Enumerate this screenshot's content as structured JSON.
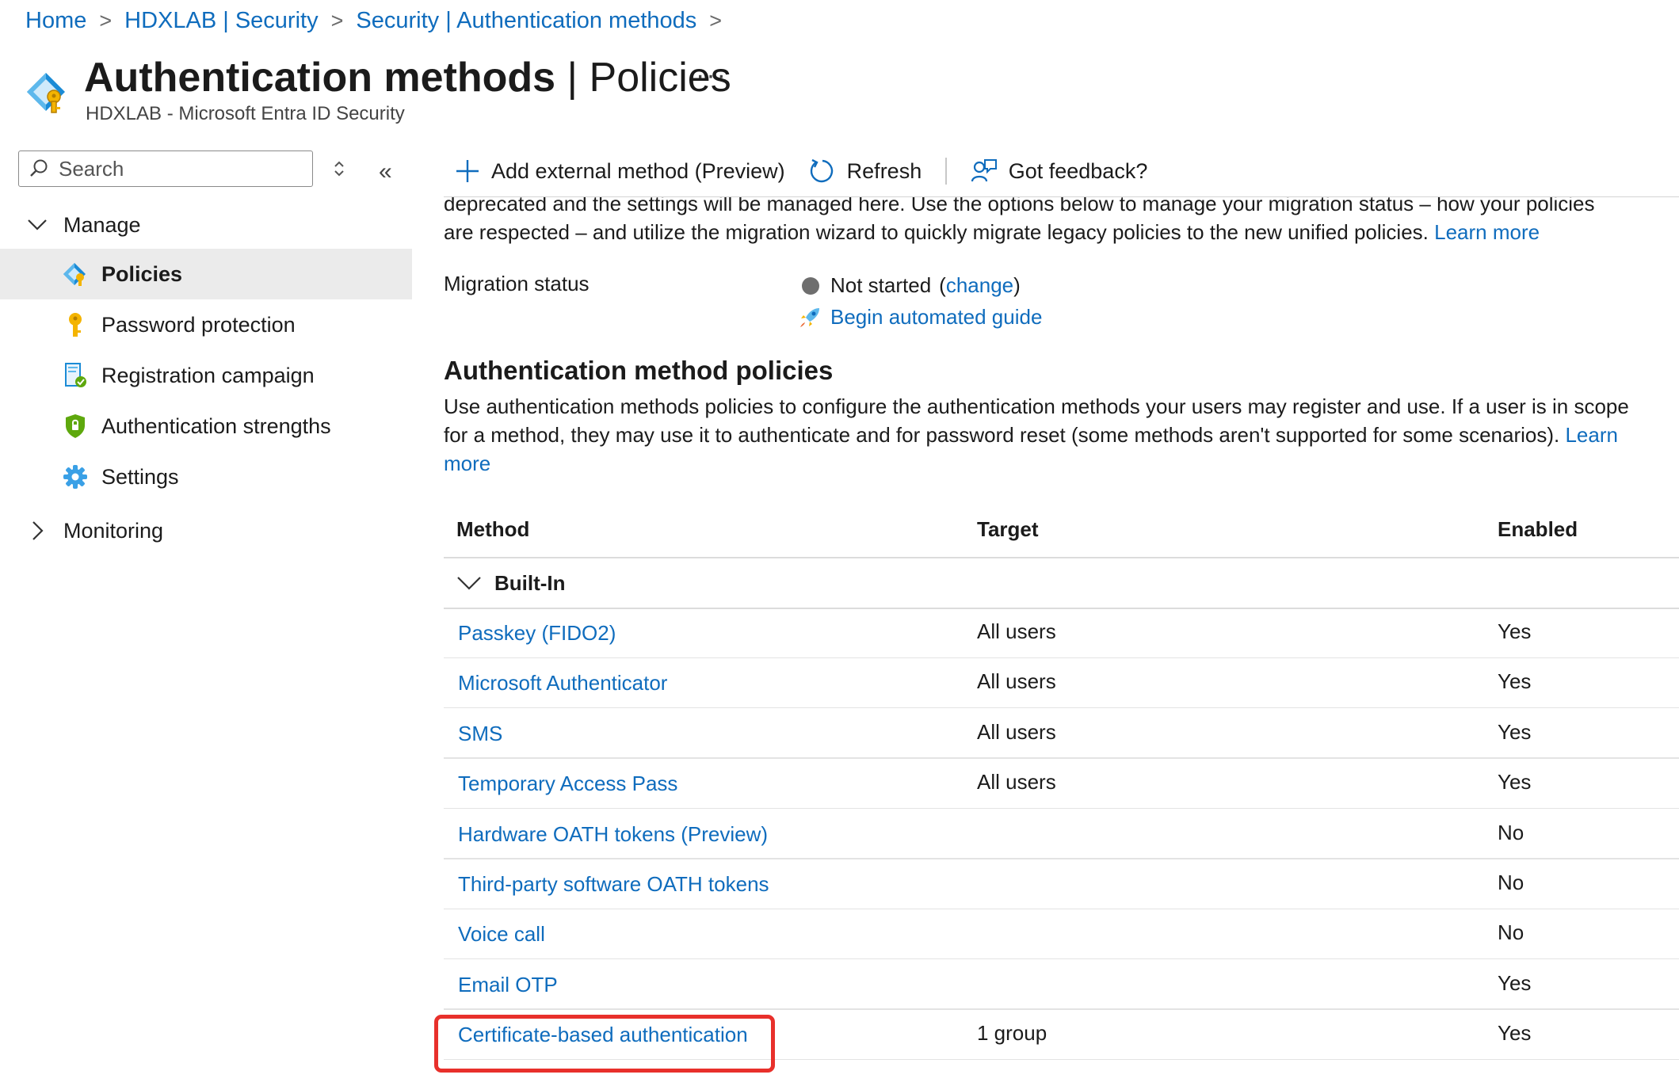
{
  "breadcrumb": [
    {
      "label": "Home"
    },
    {
      "label": "HDXLAB | Security"
    },
    {
      "label": "Security | Authentication methods"
    }
  ],
  "header": {
    "title_bold": "Authentication methods",
    "title_sep": " | ",
    "title_light": "Policies",
    "more": "···",
    "subtitle": "HDXLAB - Microsoft Entra ID Security",
    "icon": "authentication-methods-icon"
  },
  "sidebar": {
    "search_placeholder": "Search",
    "collapse_glyph": "«",
    "manage_label": "Manage",
    "monitoring_label": "Monitoring",
    "items": [
      {
        "label": "Policies",
        "icon": "policies-icon",
        "active": true
      },
      {
        "label": "Password protection",
        "icon": "key-icon"
      },
      {
        "label": "Registration campaign",
        "icon": "registration-icon"
      },
      {
        "label": "Authentication strengths",
        "icon": "shield-icon"
      },
      {
        "label": "Settings",
        "icon": "gear-icon"
      }
    ]
  },
  "toolbar": {
    "add_label": "Add external method (Preview)",
    "refresh_label": "Refresh",
    "feedback_label": "Got feedback?"
  },
  "migration": {
    "intro_line1": "deprecated and the settings will be managed here. Use the options below to manage your migration status – how your policies",
    "intro_line2": "are respected – and utilize the migration wizard to quickly migrate legacy policies to the new unified policies.",
    "learn_more": "Learn more",
    "status_label": "Migration status",
    "status_value": "Not started",
    "change_link": "change",
    "guide_link": "Begin automated guide"
  },
  "policies": {
    "title": "Authentication method policies",
    "description": "Use authentication methods policies to configure the authentication methods your users may register and use. If a user is in scope for a method, they may use it to authenticate and for password reset (some methods aren't supported for some scenarios).",
    "learn_more": "Learn more",
    "columns": {
      "method": "Method",
      "target": "Target",
      "enabled": "Enabled"
    },
    "group": "Built-In",
    "rows": [
      {
        "method": "Passkey (FIDO2)",
        "target": "All users",
        "enabled": "Yes"
      },
      {
        "method": "Microsoft Authenticator",
        "target": "All users",
        "enabled": "Yes"
      },
      {
        "method": "SMS",
        "target": "All users",
        "enabled": "Yes"
      },
      {
        "method": "Temporary Access Pass",
        "target": "All users",
        "enabled": "Yes"
      },
      {
        "method": "Hardware OATH tokens (Preview)",
        "target": "",
        "enabled": "No"
      },
      {
        "method": "Third-party software OATH tokens",
        "target": "",
        "enabled": "No"
      },
      {
        "method": "Voice call",
        "target": "",
        "enabled": "No"
      },
      {
        "method": "Email OTP",
        "target": "",
        "enabled": "Yes"
      },
      {
        "method": "Certificate-based authentication",
        "target": "1 group",
        "enabled": "Yes"
      }
    ]
  },
  "colors": {
    "link": "#0f6cbd",
    "highlight": "#e8302b",
    "active_bg": "#ebebeb"
  }
}
